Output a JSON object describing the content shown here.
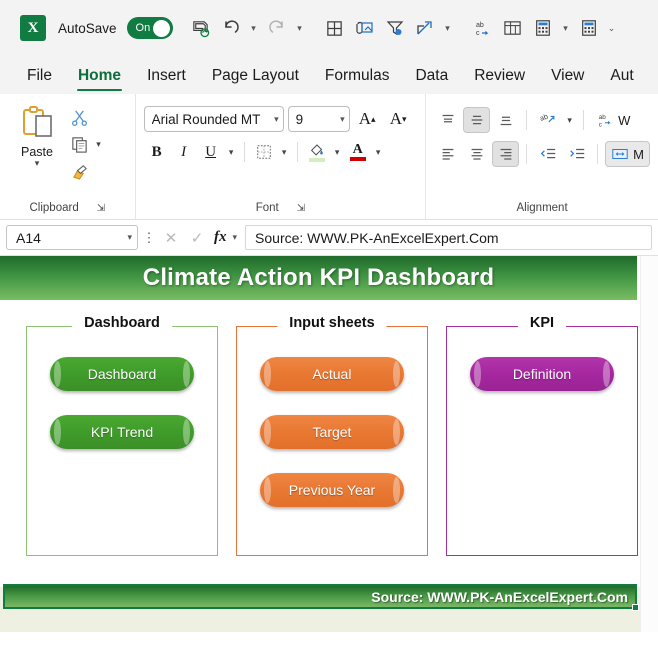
{
  "app": {
    "logo_text": "X",
    "autosave_label": "AutoSave",
    "autosave_state": "On",
    "accent_green": "#107c41"
  },
  "quick_access": {
    "items": [
      {
        "name": "save-icon",
        "label": "Save"
      },
      {
        "name": "undo-icon",
        "label": "Undo"
      },
      {
        "name": "redo-icon",
        "label": "Redo"
      },
      {
        "name": "table-grid-icon",
        "label": "Insert Table"
      },
      {
        "name": "attach-picture-icon",
        "label": "Picture"
      },
      {
        "name": "filter-settings-icon",
        "label": "Filter"
      },
      {
        "name": "share-icon",
        "label": "Share"
      },
      {
        "name": "spelling-icon",
        "label": "Spelling"
      },
      {
        "name": "pivot-table-icon",
        "label": "PivotTable"
      },
      {
        "name": "calculator-icon",
        "label": "Calculator"
      },
      {
        "name": "calculator-alt-icon",
        "label": "Calculate Now"
      },
      {
        "name": "customize-qat-icon",
        "label": "Customize Quick Access Toolbar"
      }
    ]
  },
  "ribbon": {
    "tabs": [
      {
        "label": "File",
        "active": false
      },
      {
        "label": "Home",
        "active": true
      },
      {
        "label": "Insert",
        "active": false
      },
      {
        "label": "Page Layout",
        "active": false
      },
      {
        "label": "Formulas",
        "active": false
      },
      {
        "label": "Data",
        "active": false
      },
      {
        "label": "Review",
        "active": false
      },
      {
        "label": "View",
        "active": false
      },
      {
        "label": "Aut",
        "active": false
      }
    ],
    "groups": {
      "clipboard": {
        "label": "Clipboard",
        "paste_label": "Paste",
        "cut_label": "Cut",
        "copy_label": "Copy",
        "format_painter_label": "Format Painter"
      },
      "font": {
        "label": "Font",
        "font_name": "Arial Rounded MT",
        "font_size": "9",
        "grow_label": "A",
        "shrink_label": "A",
        "bold_label": "B",
        "italic_label": "I",
        "underline_label": "U",
        "borders_label": "Borders",
        "fill_color_label": "Fill Color",
        "font_color_label": "A"
      },
      "alignment": {
        "label": "Alignment",
        "top_align_label": "Top Align",
        "middle_align_label": "Middle Align",
        "bottom_align_label": "Bottom Align",
        "orientation_label": "Orientation",
        "align_left_label": "Align Left",
        "center_label": "Center",
        "align_right_label": "Align Right",
        "decrease_indent_label": "Decrease Indent",
        "increase_indent_label": "Increase Indent",
        "wrap_text_label": "W",
        "merge_center_label": "M"
      }
    }
  },
  "formula_bar": {
    "name_box": "A14",
    "cancel_label": "✕",
    "enter_label": "✓",
    "fx_label": "fx",
    "content": "Source: WWW.PK-AnExcelExpert.Com"
  },
  "sheet": {
    "dashboard_title": "Climate Action KPI Dashboard",
    "source_bar": "Source: WWW.PK-AnExcelExpert.Com",
    "panels": [
      {
        "title": "Dashboard",
        "color": "#8cc273",
        "buttons": [
          {
            "label": "Dashboard"
          },
          {
            "label": "KPI Trend"
          }
        ]
      },
      {
        "title": "Input sheets",
        "color": "#e8743b",
        "buttons": [
          {
            "label": "Actual"
          },
          {
            "label": "Target"
          },
          {
            "label": "Previous Year"
          }
        ]
      },
      {
        "title": "KPI",
        "color": "#a8309e",
        "buttons": [
          {
            "label": "Definition"
          }
        ]
      }
    ]
  }
}
